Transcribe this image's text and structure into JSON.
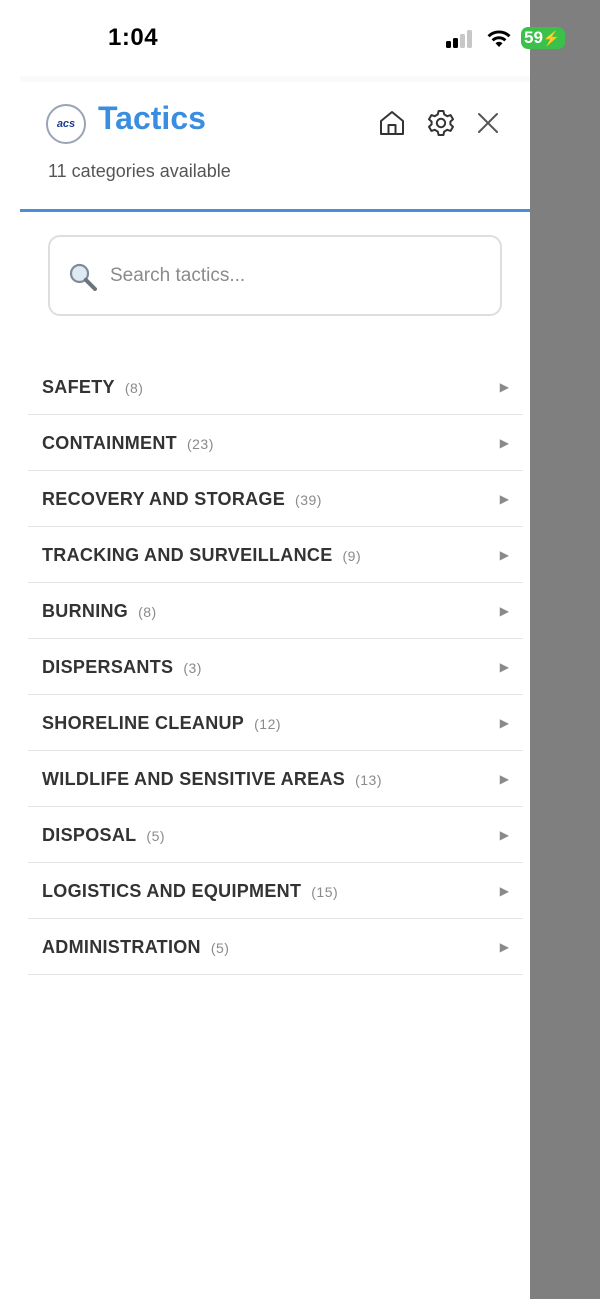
{
  "status_bar": {
    "time": "1:04",
    "battery": "59"
  },
  "header": {
    "logo_text": "acs",
    "title": "Tactics",
    "subtitle": "11 categories available",
    "icons": [
      "home-icon",
      "settings-gear-icon",
      "close-icon"
    ]
  },
  "search": {
    "placeholder": "Search tactics...",
    "value": ""
  },
  "categories": [
    {
      "label": "SAFETY",
      "count": "(8)"
    },
    {
      "label": "CONTAINMENT",
      "count": "(23)"
    },
    {
      "label": "RECOVERY AND STORAGE",
      "count": "(39)"
    },
    {
      "label": "TRACKING AND SURVEILLANCE",
      "count": "(9)"
    },
    {
      "label": "BURNING",
      "count": "(8)"
    },
    {
      "label": "DISPERSANTS",
      "count": "(3)"
    },
    {
      "label": "SHORELINE CLEANUP",
      "count": "(12)"
    },
    {
      "label": "WILDLIFE AND SENSITIVE AREAS",
      "count": "(13)"
    },
    {
      "label": "DISPOSAL",
      "count": "(5)"
    },
    {
      "label": "LOGISTICS AND EQUIPMENT",
      "count": "(15)"
    },
    {
      "label": "ADMINISTRATION",
      "count": "(5)"
    }
  ],
  "colors": {
    "accent": "#3a8ee0",
    "divider": "#4a8fd8",
    "battery": "#3bc14a",
    "backdrop": "#7f7f7f"
  }
}
